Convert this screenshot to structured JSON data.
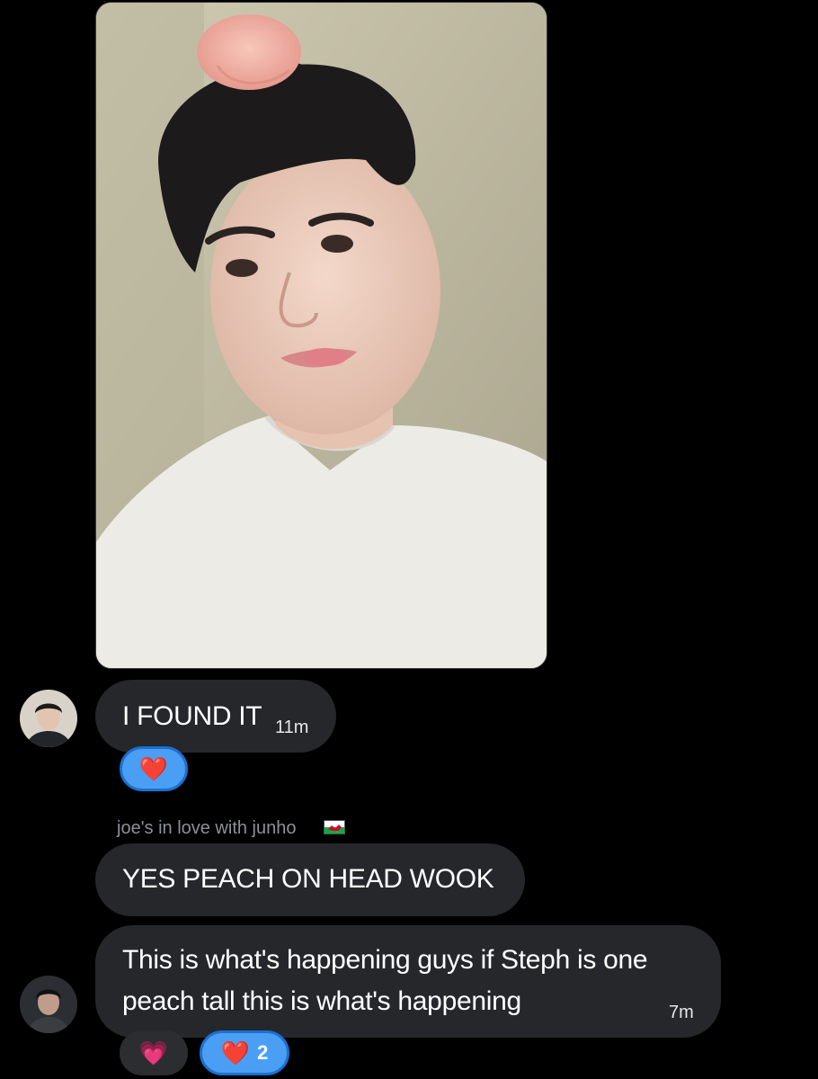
{
  "messages": [
    {
      "text": "I FOUND IT",
      "time": "11m",
      "reactions": [
        {
          "emoji": "❤️",
          "count": ""
        }
      ]
    },
    {
      "sender": "joe's in love with junho",
      "text": "YES PEACH ON HEAD WOOK"
    },
    {
      "text_line1": "This is what's happening guys if Steph is one",
      "text_line2": "peach tall this is what's happening",
      "time": "7m",
      "reactions": [
        {
          "emoji": "💗",
          "count": ""
        },
        {
          "emoji": "❤️",
          "count": "2"
        }
      ]
    }
  ],
  "colors": {
    "background": "#000000",
    "bubble": "#25272b",
    "reaction_active": "#4a9ff5",
    "reaction_inactive": "#2c2d31",
    "sender_name": "#8c9196"
  }
}
